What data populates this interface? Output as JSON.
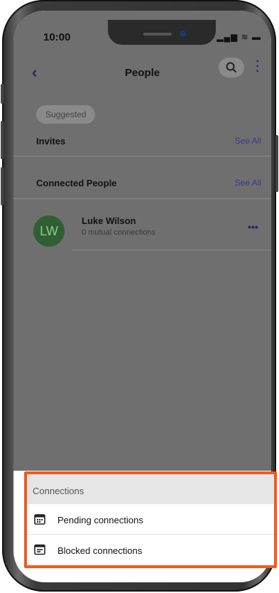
{
  "status": {
    "time": "10:00"
  },
  "header": {
    "title": "People"
  },
  "filters": {
    "chip_label": "Suggested"
  },
  "sections": {
    "invites": {
      "label": "Invites",
      "see_all": "See All"
    },
    "connected": {
      "label": "Connected People",
      "see_all": "See All"
    }
  },
  "person": {
    "initials": "LW",
    "name": "Luke Wilson",
    "subtitle": "0 mutual connections",
    "more": "•••"
  },
  "sheet": {
    "title": "Connections",
    "items": [
      {
        "label": "Pending connections",
        "icon": "calendar-icon"
      },
      {
        "label": "Blocked connections",
        "icon": "blocked-list-icon"
      }
    ]
  },
  "colors": {
    "accent": "#3b3891",
    "highlight": "#f15a1d",
    "avatar": "#2f5f32",
    "overlay": "#6f6f6f"
  }
}
